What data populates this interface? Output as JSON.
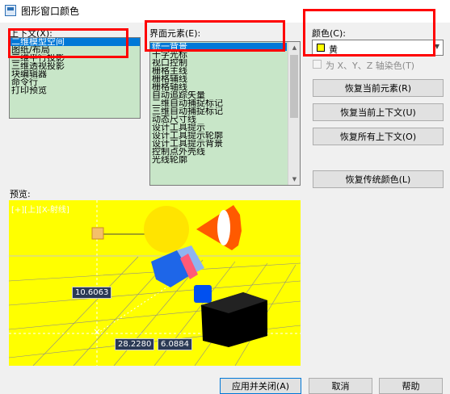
{
  "window": {
    "title": "图形窗口颜色"
  },
  "context": {
    "label": "上下文(X):",
    "items": [
      "二维模型空间",
      "图纸/布局",
      "三维平行投影",
      "三维透视投影",
      "块编辑器",
      "命令行",
      "打印预览"
    ],
    "selected_index": 0
  },
  "elements": {
    "label": "界面元素(E):",
    "items": [
      "统一背景",
      "十字光标",
      "视口控制",
      "栅格主线",
      "栅格辅线",
      "栅格轴线",
      "自动追踪矢量",
      "二维自动捕捉标记",
      "三维自动捕捉标记",
      "动态尺寸线",
      "设计工具提示",
      "设计工具提示轮廓",
      "设计工具提示背景",
      "控制点外壳线",
      "光线轮廓"
    ],
    "selected_index": 0
  },
  "color": {
    "label": "颜色(C):",
    "value": "黄",
    "swatch": "#ffff00",
    "tint_checkbox_label": "为 X、Y、Z 轴染色(T)",
    "tint_checked": false
  },
  "restore_buttons": {
    "current_element": "恢复当前元素(R)",
    "current_context": "恢复当前上下文(U)",
    "all_contexts": "恢复所有上下文(O)",
    "classic_colors": "恢复传统颜色(L)"
  },
  "preview": {
    "label": "预览:",
    "view_label": "[+][上][X-射线]",
    "dim_1": "10.6063",
    "dim_2": "28.2280",
    "dim_3": "6.0884"
  },
  "footer": {
    "apply_close": "应用并关闭(A)",
    "cancel": "取消",
    "help": "帮助"
  },
  "colors": {
    "highlight": "#ff0000",
    "list_bg": "#c8e6c8",
    "selection": "#0078d7",
    "preview_bg": "#ffff00"
  }
}
